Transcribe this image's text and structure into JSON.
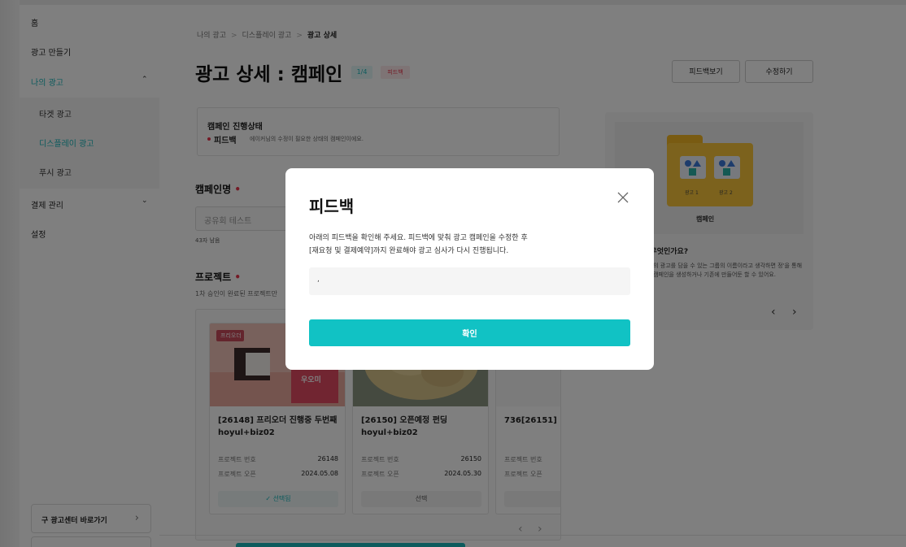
{
  "sidebar": {
    "home": "홈",
    "create_ad": "광고 만들기",
    "my_ads": "나의 광고",
    "sub": [
      "타겟 광고",
      "디스플레이 광고",
      "푸시 광고"
    ],
    "billing": "결제 관리",
    "settings": "설정",
    "old_center": "구 광고센터 바로가기"
  },
  "breadcrumb": [
    "나의 광고",
    "디스플레이 광고",
    "광고 상세"
  ],
  "page": {
    "title": "광고 상세 : 캠페인",
    "count_badge": "1/4",
    "status_badge": "피드백",
    "feedback_view": "피드백보기",
    "edit": "수정하기"
  },
  "status_card": {
    "title": "캠페인 진행상태",
    "status": "피드백",
    "desc": "에이커님의 수정이 필요한 상태의 캠페인이에요."
  },
  "campaign": {
    "label": "캠페인명",
    "required": "•",
    "value": "공유회 테스트",
    "counter": "43자 남음"
  },
  "project": {
    "label": "프로젝트",
    "required": "•",
    "desc": "1차 승인이 완료된 프로젝트만"
  },
  "projects": [
    {
      "name": "[26148] 프리오더 진행중 두번째 hoyul+biz02",
      "no_label": "프로젝트 번호",
      "no": "26148",
      "date_label": "프로젝트 오픈",
      "date": "2024.05.08",
      "select": "✓ 선택됨",
      "tag": "프리오더",
      "img_text": "우오미"
    },
    {
      "name": "[26150] 오픈예정 펀딩 hoyul+biz02",
      "no_label": "프로젝트 번호",
      "no": "26150",
      "date_label": "프로젝트 오픈",
      "date": "2024.05.30",
      "select": "선택"
    },
    {
      "name": "736[26151] hoyul.lee+bi",
      "no_label": "프로젝트 번호",
      "date_label": "프로젝트 오픈"
    }
  ],
  "right_panel": {
    "ad1": "광고 1",
    "ad2": "광고 2",
    "folder_label": "캠페인",
    "question": "이 무엇인가요?",
    "answer": "러 개의 광고를 담을 수 있는 그룹의 이름이라고 생각하면 정'을 통해 신규 캠페인을 생성하거나 기존에 만들어둔 할 수 있어요."
  },
  "modal": {
    "title": "피드백",
    "message_line1": "아래의 피드백을 확인해 주세요. 피드백에 맞춰 광고 캠페인을 수정한 후",
    "message_line2": "[재요청 및 결제예약]까지 완료해야 광고 심사가 다시 진행됩니다.",
    "feedback_text": ",",
    "confirm": "확인"
  },
  "icons": {
    "nav": [
      "chevron-up-icon",
      "chevron-down-icon",
      "chevron-right-icon",
      "chevron-left-icon",
      "close-icon"
    ]
  },
  "colors": {
    "accent": "#1bb6ba",
    "button": "#11c2c4",
    "alert": "#e8334a"
  }
}
